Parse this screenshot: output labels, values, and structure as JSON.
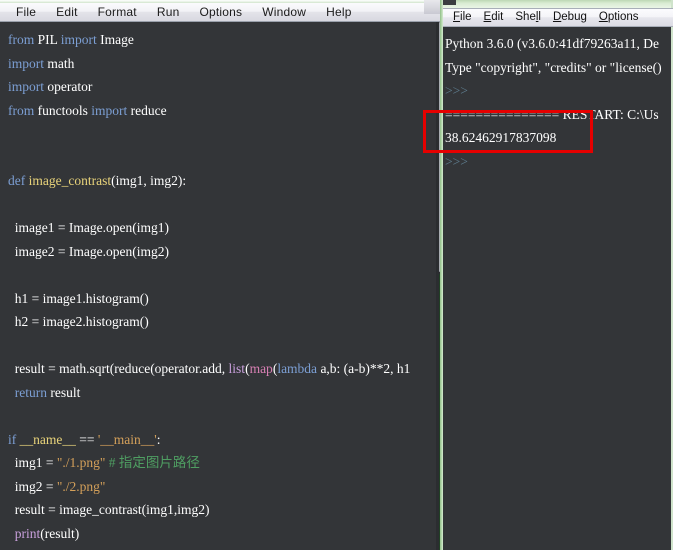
{
  "editor": {
    "window_name": "python-idle-editor",
    "menu": [
      {
        "label": "File"
      },
      {
        "label": "Edit"
      },
      {
        "label": "Format"
      },
      {
        "label": "Run"
      },
      {
        "label": "Options"
      },
      {
        "label": "Window"
      },
      {
        "label": "Help"
      }
    ],
    "code_lines": [
      {
        "id": "l1",
        "text": "from PIL import Image"
      },
      {
        "id": "l2",
        "text": "import math"
      },
      {
        "id": "l3",
        "text": "import operator"
      },
      {
        "id": "l4",
        "text": "from functools import reduce"
      },
      {
        "id": "l5",
        "text": ""
      },
      {
        "id": "l6",
        "text": ""
      },
      {
        "id": "l7",
        "text": "def image_contrast(img1, img2):"
      },
      {
        "id": "l8",
        "text": ""
      },
      {
        "id": "l9",
        "text": "  image1 = Image.open(img1)"
      },
      {
        "id": "l10",
        "text": "  image2 = Image.open(img2)"
      },
      {
        "id": "l11",
        "text": ""
      },
      {
        "id": "l12",
        "text": "  h1 = image1.histogram()"
      },
      {
        "id": "l13",
        "text": "  h2 = image2.histogram()"
      },
      {
        "id": "l14",
        "text": ""
      },
      {
        "id": "l15",
        "text": "  result = math.sqrt(reduce(operator.add,  list(map(lambda a,b: (a-b)**2, h1"
      },
      {
        "id": "l16",
        "text": "  return result"
      },
      {
        "id": "l17",
        "text": ""
      },
      {
        "id": "l18",
        "text": "if __name__ == '__main__':"
      },
      {
        "id": "l19",
        "text": "  img1 = \"./1.png\" # 指定图片路径"
      },
      {
        "id": "l20",
        "text": "  img2 = \"./2.png\""
      },
      {
        "id": "l21",
        "text": "  result = image_contrast(img1,img2)"
      },
      {
        "id": "l22",
        "text": "  print(result)"
      }
    ],
    "scrollbar": {
      "name": "editor-vertical-scrollbar",
      "thumb_top_pct": 0,
      "thumb_height_pct": 47
    }
  },
  "shell": {
    "window_name": "python-3-6-0-shell",
    "menu": [
      {
        "label": "File",
        "accel": "F"
      },
      {
        "label": "Edit",
        "accel": "E"
      },
      {
        "label": "Shell",
        "accel": "l"
      },
      {
        "label": "Debug",
        "accel": "D"
      },
      {
        "label": "Options",
        "accel": "O"
      }
    ],
    "output_lines": [
      {
        "id": "s1",
        "text": "Python 3.6.0 (v3.6.0:41df79263a11, De"
      },
      {
        "id": "s2",
        "text": "Type \"copyright\", \"credits\" or \"license()"
      },
      {
        "id": "s3",
        "text": ">>>"
      },
      {
        "id": "s4",
        "text": "=============== RESTART: C:\\Us"
      },
      {
        "id": "s5",
        "text": "38.62462917837098"
      },
      {
        "id": "s6",
        "text": ">>>"
      }
    ],
    "result_value": "38.62462917837098"
  },
  "annotation": {
    "name": "red-highlight-rectangle",
    "color": "#e60000",
    "targets": "38.62462917837098"
  },
  "colors": {
    "editor_bg": "#333538",
    "shell_bg": "#333538",
    "menubar_bg": "#f2f2f6",
    "keyword": "#7c9fd4",
    "function_name": "#e8d37a",
    "builtin": "#c9a0dc",
    "string": "#d4a05a",
    "comment": "#4f9e62",
    "prompt": "#5d7b8c",
    "annotation_red": "#e60000",
    "window_frame_green": "#cfe3cb"
  }
}
